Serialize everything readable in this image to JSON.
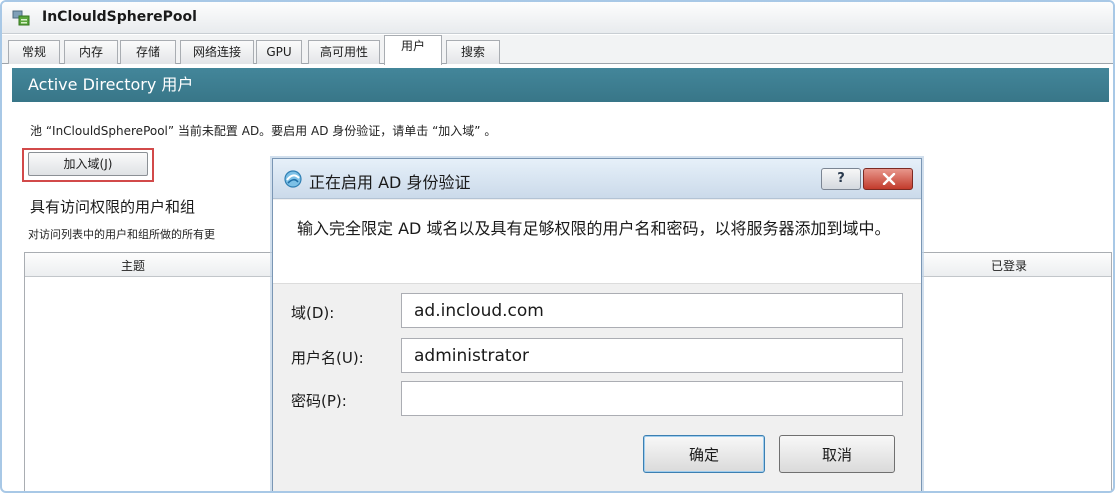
{
  "window": {
    "title": "InClouldSpherePool",
    "icon": "pool-icon"
  },
  "tabs": [
    {
      "label": "常规"
    },
    {
      "label": "内存"
    },
    {
      "label": "存储"
    },
    {
      "label": "网络连接"
    },
    {
      "label": "GPU"
    },
    {
      "label": "高可用性"
    },
    {
      "label": "用户",
      "selected": true
    },
    {
      "label": "搜索"
    }
  ],
  "section": {
    "title": "Active Directory 用户"
  },
  "notice": "池 “InClouldSpherePool” 当前未配置 AD。要启用 AD 身份验证，请单击 “加入域” 。",
  "join_button": "加入域(J)",
  "access": {
    "heading": "具有访问权限的用户和组",
    "description": "对访问列表中的用户和组所做的所有更"
  },
  "table": {
    "columns": [
      "主题",
      "已登录"
    ]
  },
  "dialog": {
    "icon": "ad-auth-icon",
    "title": "正在启用 AD 身份验证",
    "help_label": "?",
    "close_icon": "close-icon",
    "message": "输入完全限定 AD 域名以及具有足够权限的用户名和密码，以将服务器添加到域中。",
    "fields": [
      {
        "label": "域(D):",
        "value": "ad.incloud.com"
      },
      {
        "label": "用户名(U):",
        "value": "administrator"
      },
      {
        "label": "密码(P):",
        "value": ""
      }
    ],
    "ok_label": "确定",
    "cancel_label": "取消"
  },
  "colors": {
    "section_header": "#3e7e90",
    "join_highlight": "#d24a4a",
    "close_button": "#c23b2c",
    "ok_border": "#3c7fb1",
    "frame": "#a8c8e6"
  }
}
